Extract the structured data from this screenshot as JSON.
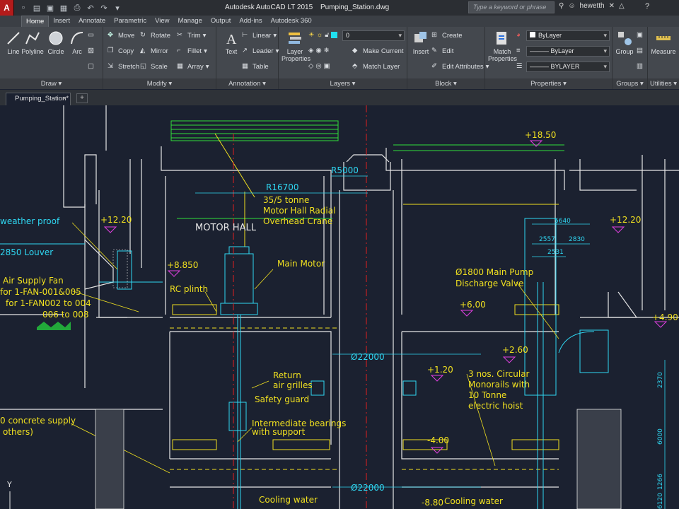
{
  "titlebar": {
    "app_letter": "A",
    "app_name": "Autodesk AutoCAD LT 2015",
    "file_name": "Pumping_Station.dwg",
    "search_placeholder": "Type a keyword or phrase",
    "user": "hewetth",
    "help": "?"
  },
  "tabs": [
    "Home",
    "Insert",
    "Annotate",
    "Parametric",
    "View",
    "Manage",
    "Output",
    "Add-ins",
    "Autodesk 360"
  ],
  "ribbon": {
    "draw": {
      "title": "Draw",
      "line": "Line",
      "polyline": "Polyline",
      "circle": "Circle",
      "arc": "Arc"
    },
    "modify": {
      "title": "Modify",
      "move": "Move",
      "rotate": "Rotate",
      "trim": "Trim",
      "copy": "Copy",
      "mirror": "Mirror",
      "fillet": "Fillet",
      "stretch": "Stretch",
      "scale": "Scale",
      "array": "Array"
    },
    "annotation": {
      "title": "Annotation",
      "text": "Text",
      "linear": "Linear",
      "leader": "Leader",
      "table": "Table"
    },
    "layers": {
      "title": "Layers",
      "layer_properties": "Layer Properties",
      "current_layer": "0",
      "make_current": "Make Current",
      "match_layer": "Match Layer"
    },
    "block": {
      "title": "Block",
      "insert": "Insert",
      "create": "Create",
      "edit": "Edit",
      "edit_attributes": "Edit Attributes"
    },
    "properties": {
      "title": "Properties",
      "match_properties": "Match Properties",
      "color": "ByLayer",
      "linetype": "ByLayer",
      "lineweight": "BYLAYER"
    },
    "groups": {
      "title": "Groups",
      "group": "Group"
    },
    "utilities": {
      "title": "Utilities",
      "measure": "Measure"
    }
  },
  "file_tab": {
    "label": "Pumping_Station*",
    "add": "+"
  },
  "drawing": {
    "labels": {
      "motor_hall": "MOTOR HALL",
      "crane": [
        "35/5 tonne",
        "Motor Hall Radial",
        "Overhead Crane"
      ],
      "r16700": "R16700",
      "r5000": "R5000",
      "lvl_1850": "+18.50",
      "lvl_1220_left": "+12.20",
      "lvl_1220_right": "+12.20",
      "lvl_8850": "+8.850",
      "lvl_600": "+6.00",
      "lvl_490": "+4.90",
      "lvl_260": "+2.60",
      "lvl_120": "+1.20",
      "lvl_m400": "-4.00",
      "lvl_m880": "-8.80",
      "weatherproof": "weather proof",
      "louver": "2850 Louver",
      "air_supply": [
        "Air Supply Fan",
        "for 1-FAN-001&005",
        "for 1-FAN002 to 004",
        "006 to 008"
      ],
      "rc_plinth": "RC plinth",
      "main_motor": "Main Motor",
      "discharge_valve": [
        "Ø1800 Main Pump",
        "Discharge Valve"
      ],
      "dia_22000_top": "Ø22000",
      "dia_22000_bottom": "Ø22000",
      "return_grilles": [
        "Return",
        "air grilles"
      ],
      "safety_guard": "Safety guard",
      "monorails": [
        "3 nos. Circular",
        "Monorails with",
        "10 Tonne",
        "electric hoist"
      ],
      "intermediate_bearings": [
        "Intermediate bearings",
        "with support"
      ],
      "concrete_supply": [
        "0 concrete supply",
        "others)"
      ],
      "cooling_water_left": "Cooling water",
      "cooling_water_right": "Cooling water",
      "dim_5640": "5640",
      "dim_2557": "2557",
      "dim_2830": "2830",
      "dim_2531": "2531",
      "dim_2370": "2370",
      "dim_6000": "6000",
      "dim_1266": "1266",
      "dim_6120": "6120",
      "axis_y": "Y"
    }
  }
}
